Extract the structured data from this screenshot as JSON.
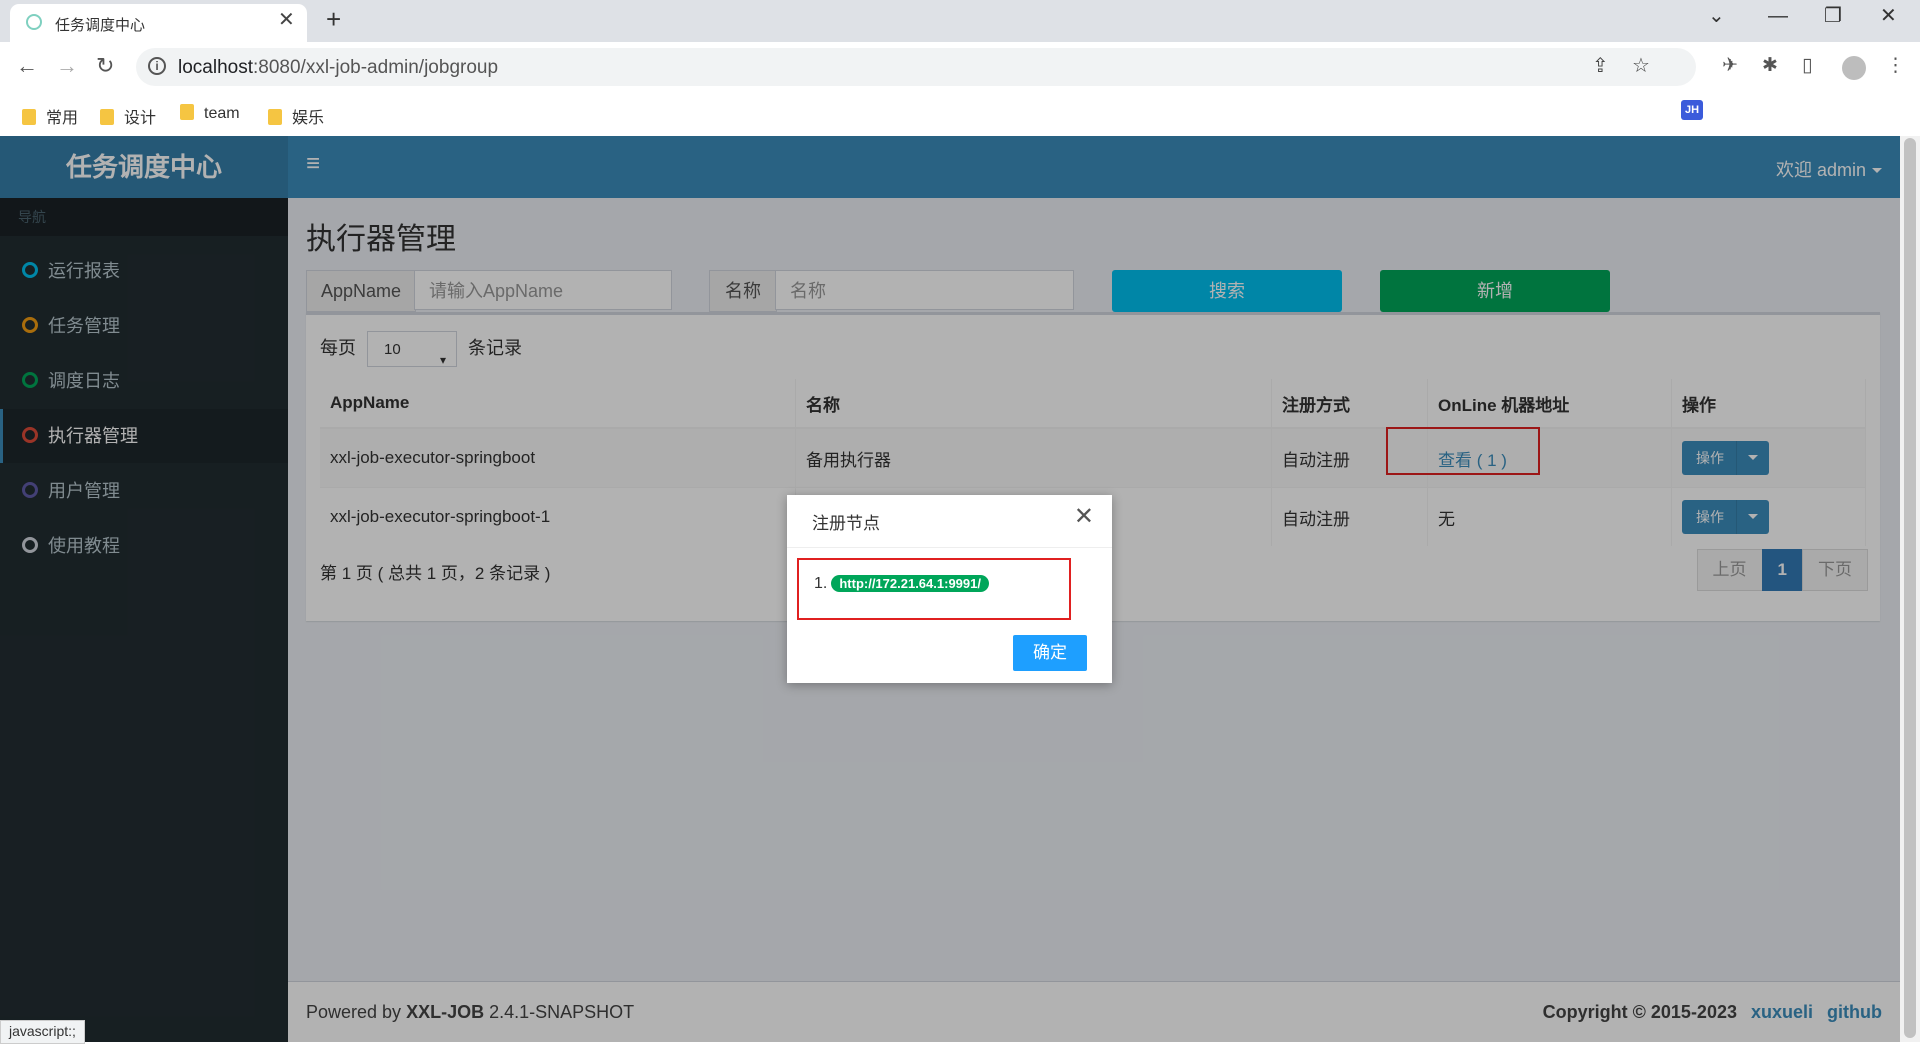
{
  "browser": {
    "tab_title": "任务调度中心",
    "url_host": "localhost",
    "url_rest": ":8080/xxl-job-admin/jobgroup",
    "bookmarks": [
      "常用",
      "设计",
      "team",
      "娱乐"
    ],
    "status_text": "javascript:;"
  },
  "app": {
    "logo": "任务调度中心",
    "welcome": "欢迎 admin",
    "nav_header": "导航",
    "nav": [
      {
        "label": "运行报表",
        "color": "#00c0ef"
      },
      {
        "label": "任务管理",
        "color": "#f39c12"
      },
      {
        "label": "调度日志",
        "color": "#00a65a"
      },
      {
        "label": "执行器管理",
        "color": "#dd4b39"
      },
      {
        "label": "用户管理",
        "color": "#605ca8"
      },
      {
        "label": "使用教程",
        "color": "#d2d6de"
      }
    ]
  },
  "main": {
    "title": "执行器管理",
    "filter_appname_label": "AppName",
    "filter_appname_placeholder": "请输入AppName",
    "filter_name_label": "名称",
    "filter_name_placeholder": "名称",
    "search_label": "搜索",
    "add_label": "新增",
    "per_page_prefix": "每页",
    "per_page_value": "10",
    "per_page_suffix": "条记录",
    "columns": [
      "AppName",
      "名称",
      "注册方式",
      "OnLine 机器地址",
      "操作"
    ],
    "rows": [
      {
        "appname": "xxl-job-executor-springboot",
        "name": "备用执行器",
        "reg": "自动注册",
        "online": "查看 ( 1 )",
        "op": "操作"
      },
      {
        "appname": "xxl-job-executor-springboot-1",
        "name": "",
        "reg": "自动注册",
        "online": "无",
        "op": "操作"
      }
    ],
    "page_info": "第 1 页 ( 总共 1 页，2 条记录 )",
    "pager": {
      "prev": "上页",
      "current": "1",
      "next": "下页"
    }
  },
  "footer": {
    "powered_prefix": "Powered by ",
    "product": "XXL-JOB",
    "version": " 2.4.1-SNAPSHOT",
    "copyright": "Copyright © 2015-2023",
    "author_link": "xuxueli",
    "github_link": "github"
  },
  "dialog": {
    "title": "注册节点",
    "item_index": "1.",
    "item_url": "http://172.21.64.1:9991/",
    "ok_label": "确定"
  },
  "colors": {
    "brand": "#3c8dbc",
    "sidebar": "#222d32",
    "success": "#00a65a",
    "info": "#00c0ef",
    "highlight": "#e02020"
  }
}
